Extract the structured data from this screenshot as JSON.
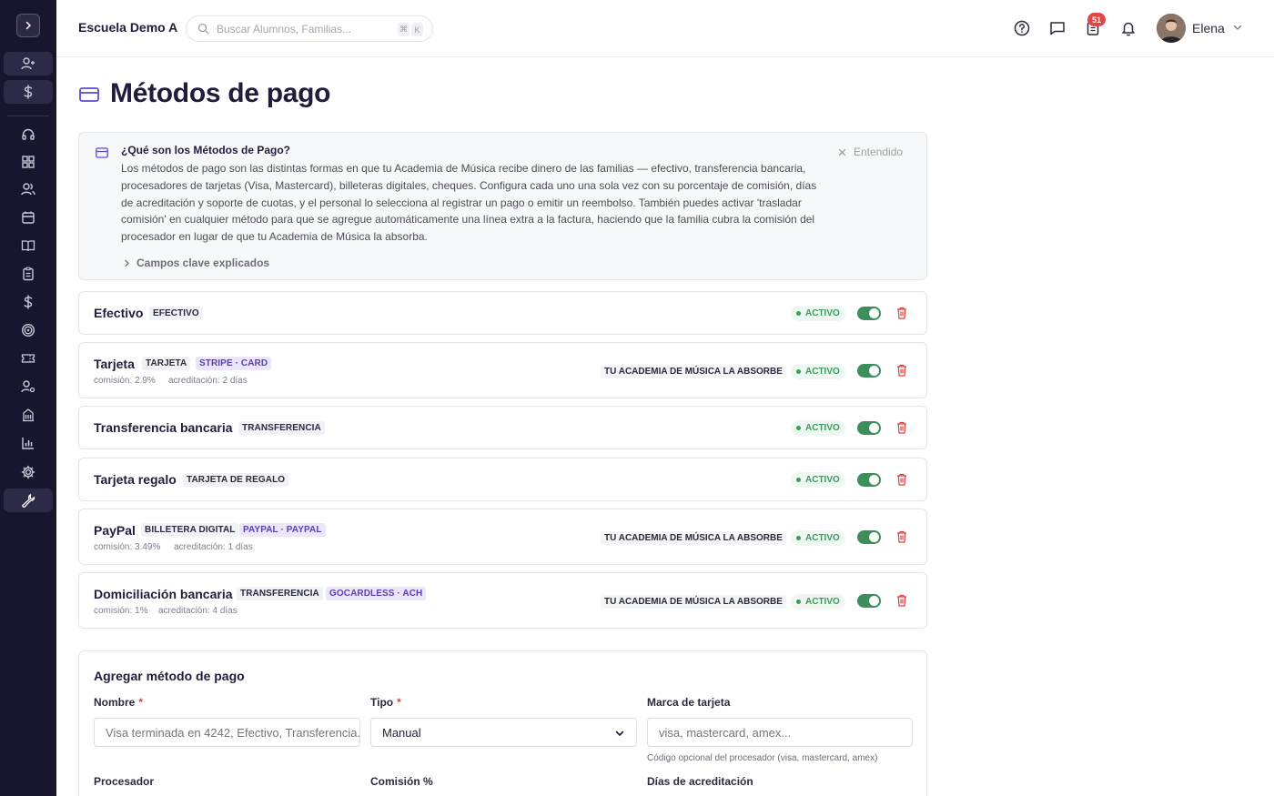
{
  "topbar": {
    "school_name": "Escuela Demo A",
    "search_placeholder": "Buscar Alumnos, Familias...",
    "shortcut_cmd": "⌘",
    "shortcut_key": "K",
    "tasks_badge": "51",
    "user_name": "Elena"
  },
  "page": {
    "title": "Métodos de pago"
  },
  "info": {
    "title": "¿Qué son los Métodos de Pago?",
    "body": "Los métodos de pago son las distintas formas en que tu Academia de Música recibe dinero de las familias — efectivo, transferencia bancaria, procesadores de tarjetas (Visa, Mastercard), billeteras digitales, cheques. Configura cada uno una sola vez con su porcentaje de comisión, días de acreditación y soporte de cuotas, y el personal lo selecciona al registrar un pago o emitir un reembolso. También puedes activar 'trasladar comisión' en cualquier método para que se agregue automáticamente una línea extra a la factura, haciendo que la familia cubra la comisión del procesador en lugar de que tu Academia de Música la absorba.",
    "dismiss_label": "Entendido",
    "more_label": "Campos clave explicados"
  },
  "methods": [
    {
      "name": "Efectivo",
      "type": "EFECTIVO",
      "status": "ACTIVO"
    },
    {
      "name": "Tarjeta",
      "type": "TARJETA",
      "processor": "STRIPE · CARD",
      "commission": "comisión: 2.9%",
      "settlement": "acreditación: 2 días",
      "absorb": "TU ACADEMIA DE MÚSICA LA ABSORBE",
      "status": "ACTIVO"
    },
    {
      "name": "Transferencia bancaria",
      "type": "TRANSFERENCIA",
      "status": "ACTIVO"
    },
    {
      "name": "Tarjeta regalo",
      "type": "TARJETA DE REGALO",
      "status": "ACTIVO"
    },
    {
      "name": "PayPal",
      "type": "BILLETERA DIGITAL",
      "processor": "PAYPAL · PAYPAL",
      "commission": "comisión: 3.49%",
      "settlement": "acreditación: 1 días",
      "absorb": "TU ACADEMIA DE MÚSICA LA ABSORBE",
      "status": "ACTIVO"
    },
    {
      "name": "Domiciliación bancaria",
      "type": "TRANSFERENCIA",
      "processor": "GOCARDLESS · ACH",
      "commission": "comisión: 1%",
      "settlement": "acreditación: 4 días",
      "absorb": "TU ACADEMIA DE MÚSICA LA ABSORBE",
      "status": "ACTIVO"
    }
  ],
  "form": {
    "title": "Agregar método de pago",
    "name_label": "Nombre",
    "name_placeholder": "Visa terminada en 4242, Efectivo, Transferencia...",
    "type_label": "Tipo",
    "type_value": "Manual",
    "brand_label": "Marca de tarjeta",
    "brand_placeholder": "visa, mastercard, amex...",
    "brand_help": "Código opcional del procesador (visa, mastercard, amex)",
    "processor_label": "Procesador",
    "commission_label": "Comisión %",
    "settlement_label": "Días de acreditación",
    "required_mark": "*"
  },
  "colors": {
    "sidebar_bg": "#16162e",
    "active_green": "#3e8e5b",
    "danger_red": "#d94040",
    "processor_purple": "#ece6fb"
  }
}
